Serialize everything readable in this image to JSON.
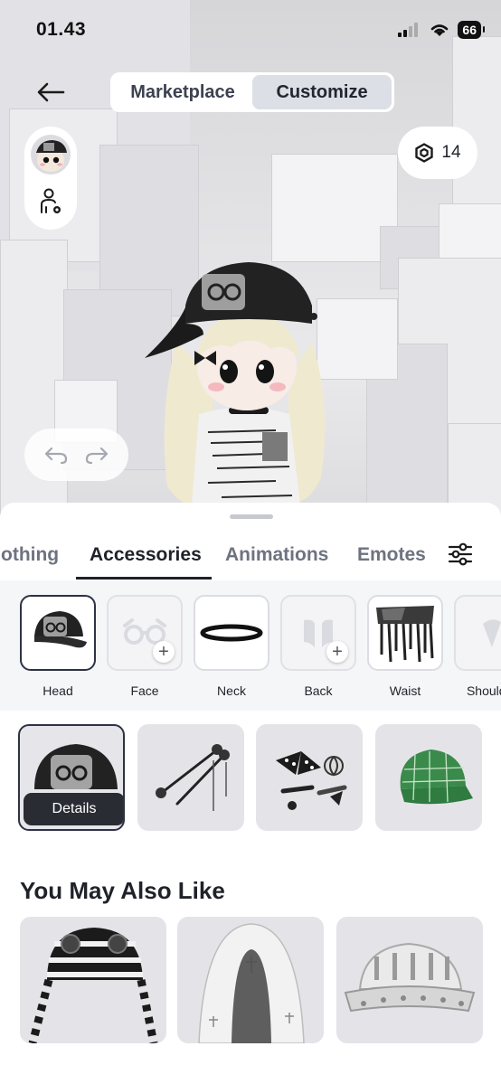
{
  "status_bar": {
    "time": "01.43",
    "battery": "66"
  },
  "top_nav": {
    "segments": [
      {
        "label": "Marketplace",
        "active": false
      },
      {
        "label": "Customize",
        "active": true
      }
    ],
    "robux_balance": "14"
  },
  "tabs": [
    {
      "label": "Clothing",
      "active": false
    },
    {
      "label": "Accessories",
      "active": true
    },
    {
      "label": "Animations",
      "active": false
    },
    {
      "label": "Emotes",
      "active": false
    }
  ],
  "categories": [
    {
      "label": "Head",
      "state": "selected",
      "icon": "cap-thumbnail"
    },
    {
      "label": "Face",
      "state": "empty",
      "icon": "glasses-icon"
    },
    {
      "label": "Neck",
      "state": "filled",
      "icon": "choker-thumbnail"
    },
    {
      "label": "Back",
      "state": "empty",
      "icon": "wings-icon"
    },
    {
      "label": "Waist",
      "state": "filled",
      "icon": "belt-thumbnail"
    },
    {
      "label": "Shoulder",
      "state": "empty",
      "icon": "shoulder-icon"
    }
  ],
  "equipped_items": [
    {
      "name": "black-cap-with-photo",
      "selected": true,
      "button": "Details"
    },
    {
      "name": "hair-pins"
    },
    {
      "name": "bows-and-clips"
    },
    {
      "name": "green-plaid-cap"
    }
  ],
  "recommendations": {
    "title": "You May Also Like",
    "items": [
      "striped-beanie",
      "white-cross-veil",
      "white-studded-cap"
    ]
  },
  "colors": {
    "accent": "#2d3245",
    "sheet_bg": "#ffffff",
    "tile_bg": "#e4e4e8"
  }
}
